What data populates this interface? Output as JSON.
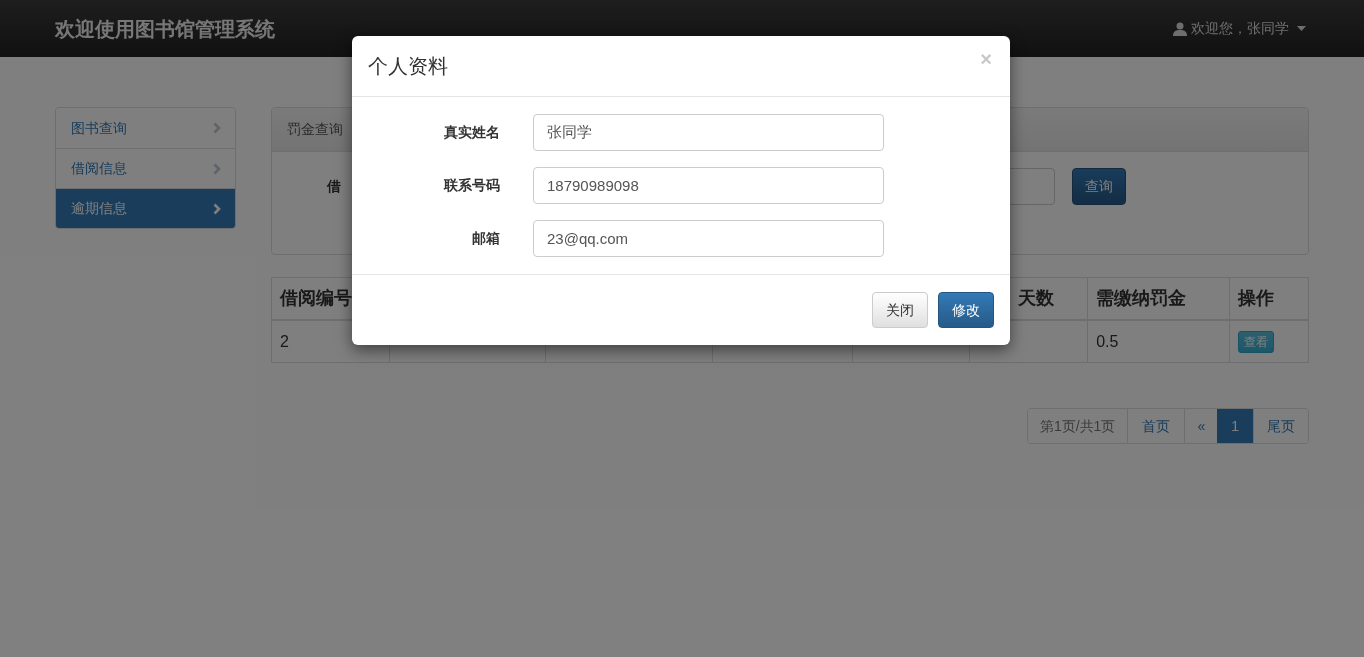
{
  "navbar": {
    "brand": "欢迎使用图书馆管理系统",
    "user": "欢迎您，张同学"
  },
  "sidebar": {
    "items": [
      {
        "label": "图书查询",
        "selected": false
      },
      {
        "label": "借阅信息",
        "selected": false
      },
      {
        "label": "逾期信息",
        "selected": true
      }
    ]
  },
  "panel": {
    "title": "罚金查询",
    "search_label": "借",
    "search_button": "查询"
  },
  "table": {
    "columns": [
      "借阅编号",
      "天数",
      "需缴纳罚金",
      "操作"
    ],
    "rows": [
      {
        "cells": [
          "2",
          null,
          "0.5"
        ],
        "action": "查看"
      }
    ]
  },
  "pagination": {
    "info": "第1页/共1页",
    "first": "首页",
    "prev": "«",
    "pages": [
      {
        "label": "1",
        "selected": true
      }
    ],
    "last": "尾页"
  },
  "modal": {
    "title": "个人资料",
    "close": "×",
    "fields": [
      {
        "label": "真实姓名",
        "value": "张同学"
      },
      {
        "label": "联系号码",
        "value": "18790989098"
      },
      {
        "label": "邮箱",
        "value": "23@qq.com"
      }
    ],
    "buttons": [
      {
        "label": "关闭",
        "kind": "default"
      },
      {
        "label": "修改",
        "kind": "primary"
      }
    ]
  }
}
